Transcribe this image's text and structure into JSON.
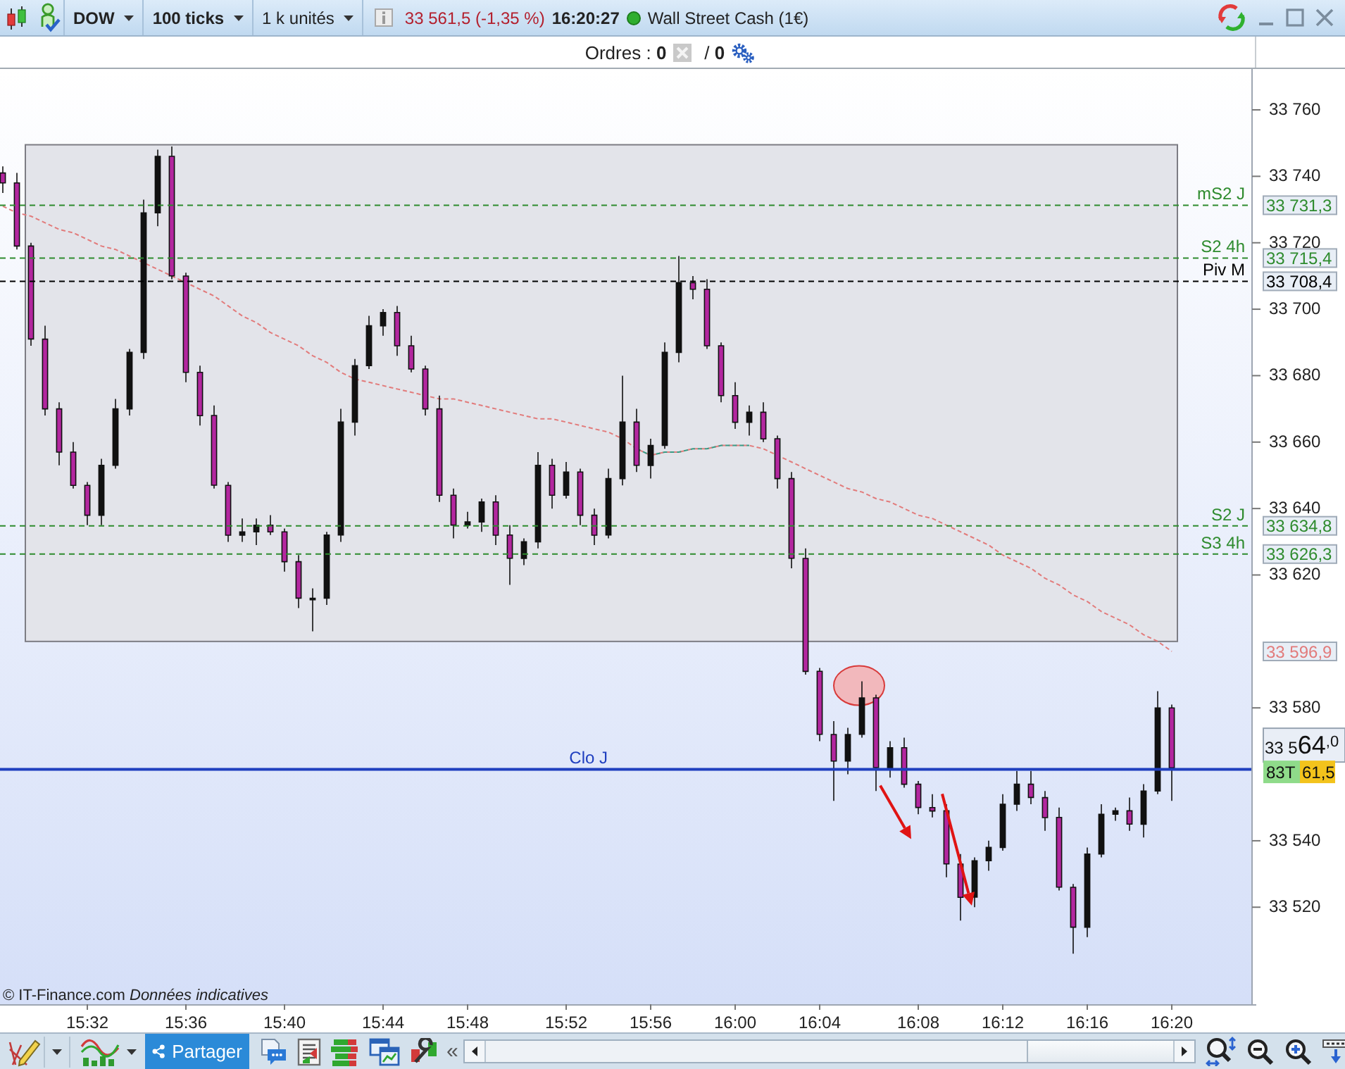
{
  "toolbar": {
    "instrument": "DOW",
    "interval": "100 ticks",
    "quantity": "1 k unités",
    "last_price": "33 561,5 (-1,35 %)",
    "time": "16:20:27",
    "market": "Wall Street Cash (1€)"
  },
  "orders_bar": {
    "orders": "Ordres : **0**",
    "pending": "/ **0**"
  },
  "chart": {
    "chart_data": {
      "type": "candlestick",
      "categories": [
        null,
        null,
        null,
        null,
        null,
        null,
        "15:32",
        null,
        null,
        null,
        null,
        null,
        null,
        "15:36",
        null,
        null,
        null,
        null,
        null,
        null,
        "15:40",
        null,
        null,
        null,
        null,
        null,
        null,
        "15:44",
        null,
        null,
        null,
        null,
        null,
        "15:48",
        null,
        null,
        null,
        null,
        null,
        null,
        "15:52",
        null,
        null,
        null,
        null,
        null,
        "15:56",
        null,
        null,
        null,
        null,
        null,
        "16:00",
        null,
        null,
        null,
        null,
        null,
        "16:04",
        null,
        null,
        null,
        null,
        null,
        null,
        "16:08",
        null,
        null,
        null,
        null,
        null,
        "16:12",
        null,
        null,
        null,
        null,
        null,
        "16:16",
        null,
        null,
        null,
        null,
        null,
        "16:20"
      ],
      "ohlc": [
        [
          33741,
          33743,
          33735,
          33738
        ],
        [
          33738,
          33741,
          33718,
          33719
        ],
        [
          33719,
          33720,
          33689,
          33691
        ],
        [
          33691,
          33695,
          33668,
          33670
        ],
        [
          33670,
          33672,
          33653,
          33657
        ],
        [
          33657,
          33660,
          33646,
          33647
        ],
        [
          33647,
          33648,
          33635,
          33638
        ],
        [
          33638,
          33655,
          33635,
          33653
        ],
        [
          33653,
          33673,
          33652,
          33670
        ],
        [
          33670,
          33688,
          33668,
          33687
        ],
        [
          33687,
          33733,
          33685,
          33729
        ],
        [
          33729,
          33748,
          33725,
          33746
        ],
        [
          33746,
          33749,
          33709,
          33710
        ],
        [
          33710,
          33711,
          33678,
          33681
        ],
        [
          33681,
          33683,
          33665,
          33668
        ],
        [
          33668,
          33671,
          33646,
          33647
        ],
        [
          33647,
          33648,
          33630,
          33632
        ],
        [
          33632,
          33637,
          33630,
          33633
        ],
        [
          33633,
          33637,
          33629,
          33635
        ],
        [
          33635,
          33638,
          33632,
          33633
        ],
        [
          33633,
          33634,
          33621,
          33624
        ],
        [
          33624,
          33626,
          33610,
          33613
        ],
        [
          33613,
          33616,
          33603,
          33613
        ],
        [
          33613,
          33633,
          33611,
          33632
        ],
        [
          33632,
          33670,
          33630,
          33666
        ],
        [
          33666,
          33685,
          33662,
          33683
        ],
        [
          33683,
          33698,
          33682,
          33695
        ],
        [
          33695,
          33700,
          33692,
          33699
        ],
        [
          33699,
          33701,
          33686,
          33689
        ],
        [
          33689,
          33692,
          33681,
          33682
        ],
        [
          33682,
          33683,
          33668,
          33670
        ],
        [
          33670,
          33674,
          33642,
          33644
        ],
        [
          33644,
          33646,
          33631,
          33635
        ],
        [
          33635,
          33639,
          33634,
          33636
        ],
        [
          33636,
          33643,
          33633,
          33642
        ],
        [
          33642,
          33644,
          33629,
          33632
        ],
        [
          33632,
          33635,
          33617,
          33625
        ],
        [
          33625,
          33631,
          33623,
          33630
        ],
        [
          33630,
          33657,
          33628,
          33653
        ],
        [
          33653,
          33655,
          33640,
          33644
        ],
        [
          33644,
          33654,
          33643,
          33651
        ],
        [
          33651,
          33652,
          33635,
          33638
        ],
        [
          33638,
          33640,
          33629,
          33632
        ],
        [
          33632,
          33652,
          33631,
          33649
        ],
        [
          33649,
          33680,
          33647,
          33666
        ],
        [
          33666,
          33670,
          33651,
          33653
        ],
        [
          33653,
          33661,
          33649,
          33659
        ],
        [
          33659,
          33690,
          33658,
          33687
        ],
        [
          33687,
          33716,
          33684,
          33708
        ],
        [
          33708,
          33710,
          33703,
          33706
        ],
        [
          33706,
          33709,
          33688,
          33689
        ],
        [
          33689,
          33690,
          33672,
          33674
        ],
        [
          33674,
          33678,
          33664,
          33666
        ],
        [
          33666,
          33671,
          33662,
          33669
        ],
        [
          33669,
          33672,
          33660,
          33661
        ],
        [
          33661,
          33662,
          33646,
          33649
        ],
        [
          33649,
          33651,
          33622,
          33625
        ],
        [
          33625,
          33628,
          33590,
          33591
        ],
        [
          33591,
          33592,
          33570,
          33572
        ],
        [
          33572,
          33576,
          33552,
          33564
        ],
        [
          33564,
          33574,
          33560,
          33572
        ],
        [
          33572,
          33588,
          33571,
          33583
        ],
        [
          33583,
          33584,
          33555,
          33562
        ],
        [
          33562,
          33570,
          33559,
          33568
        ],
        [
          33568,
          33571,
          33556,
          33557
        ],
        [
          33557,
          33558,
          33548,
          33550
        ],
        [
          33550,
          33554,
          33547,
          33549
        ],
        [
          33549,
          33551,
          33529,
          33533
        ],
        [
          33533,
          33536,
          33516,
          33523
        ],
        [
          33523,
          33535,
          33520,
          33534
        ],
        [
          33534,
          33540,
          33531,
          33538
        ],
        [
          33538,
          33554,
          33537,
          33551
        ],
        [
          33551,
          33561,
          33549,
          33557
        ],
        [
          33557,
          33561,
          33551,
          33553
        ],
        [
          33553,
          33555,
          33543,
          33547
        ],
        [
          33547,
          33550,
          33525,
          33526
        ],
        [
          33526,
          33527,
          33506,
          33514
        ],
        [
          33514,
          33538,
          33511,
          33536
        ],
        [
          33536,
          33551,
          33535,
          33548
        ],
        [
          33548,
          33550,
          33546,
          33549
        ],
        [
          33549,
          33553,
          33543,
          33545
        ],
        [
          33545,
          33557,
          33541,
          33555
        ],
        [
          33555,
          33585,
          33554,
          33580
        ],
        [
          33580,
          33581,
          33552,
          33562
        ]
      ],
      "series": [
        {
          "type": "line",
          "color": "#e27b7b",
          "line_style": "dashed",
          "values": [
            33731,
            33729,
            33728,
            33726,
            33724,
            33723,
            33721,
            33719,
            33718,
            33716,
            33714,
            33712,
            33710,
            33708,
            33706,
            33704,
            33701,
            33698,
            33696,
            33693,
            33691,
            33689,
            33686,
            33684,
            33681,
            33679,
            33678,
            33677,
            33676,
            33675,
            33674,
            33673,
            33673,
            33672,
            33671,
            33670,
            33669,
            33668,
            33667,
            33667,
            33666,
            33665,
            33664,
            33663,
            33661,
            33658,
            33656,
            33657,
            33657,
            33658,
            33658,
            33659,
            33659,
            33659,
            33658,
            33656,
            33654,
            33652,
            33650,
            33648,
            33646,
            33645,
            33643,
            33642,
            33640,
            33638,
            33637,
            33635,
            33633,
            33631,
            33629,
            33626,
            33624,
            33622,
            33619,
            33617,
            33614,
            33612,
            33609,
            33607,
            33605,
            33602,
            33600,
            33597
          ]
        },
        {
          "type": "line",
          "color": "#3a9a84",
          "line_style": "dashed",
          "values": [
            null,
            null,
            null,
            null,
            null,
            null,
            null,
            null,
            null,
            null,
            null,
            null,
            null,
            null,
            null,
            null,
            null,
            null,
            null,
            null,
            null,
            null,
            null,
            null,
            null,
            null,
            null,
            null,
            null,
            null,
            null,
            null,
            null,
            null,
            null,
            null,
            null,
            null,
            null,
            null,
            null,
            null,
            null,
            null,
            null,
            33658,
            33656,
            33657,
            33657,
            33658,
            33658,
            33659,
            33659,
            33659,
            null,
            null,
            null,
            null,
            null,
            null,
            null,
            null,
            null,
            null,
            null,
            null,
            null,
            null,
            null,
            null,
            null,
            null,
            null,
            null,
            null,
            null,
            null,
            null,
            null,
            null,
            null,
            null,
            null,
            null
          ]
        }
      ],
      "ylim": [
        33490.8,
        33772.3
      ],
      "yticks": [
        {
          "value": 33760,
          "label": "33 760"
        },
        {
          "value": 33740,
          "label": "33 740"
        },
        {
          "value": 33720,
          "label": "33 720"
        },
        {
          "value": 33700,
          "label": "33 700"
        },
        {
          "value": 33680,
          "label": "33 680"
        },
        {
          "value": 33660,
          "label": "33 660"
        },
        {
          "value": 33640,
          "label": "33 640"
        },
        {
          "value": 33620,
          "label": "33 620"
        },
        {
          "value": 33580,
          "label": "33 580"
        },
        {
          "value": 33540,
          "label": "33 540"
        },
        {
          "value": 33520,
          "label": "33 520"
        }
      ],
      "ref_lines": [
        {
          "axis": "y",
          "value": 33731.3,
          "label": "mS2 J",
          "color": "#2e8b2e",
          "line_style": "dashed"
        },
        {
          "axis": "y",
          "value": 33715.4,
          "label": "S2 4h",
          "color": "#2e8b2e",
          "line_style": "dashed"
        },
        {
          "axis": "y",
          "value": 33708.4,
          "label": "Piv M",
          "color": "#000000",
          "line_style": "dashed"
        },
        {
          "axis": "y",
          "value": 33634.8,
          "label": "S2 J",
          "color": "#2e8b2e",
          "line_style": "dashed"
        },
        {
          "axis": "y",
          "value": 33626.3,
          "label": "S3 4h",
          "color": "#2e8b2e",
          "line_style": "dashed"
        },
        {
          "axis": "y",
          "value": 33561.5,
          "label": "Clo J",
          "color": "#1f3fbf",
          "line_style": "solid"
        }
      ]
    },
    "level_tags": [
      "33 731,3",
      "33 715,4",
      "33 708,4",
      "33 634,8",
      "33 626,3"
    ],
    "average_tag": "33 596,9",
    "current_price": {
      "head": "33 5",
      "big": "64",
      "tail": ",0"
    },
    "tick_badge": "83T",
    "price_badge": "61,5",
    "copyright": "© IT-Finance.com",
    "disclaimer": "Données indicatives"
  },
  "bottom_toolbar": {
    "share_button": "Partager",
    "collapse": "«"
  }
}
